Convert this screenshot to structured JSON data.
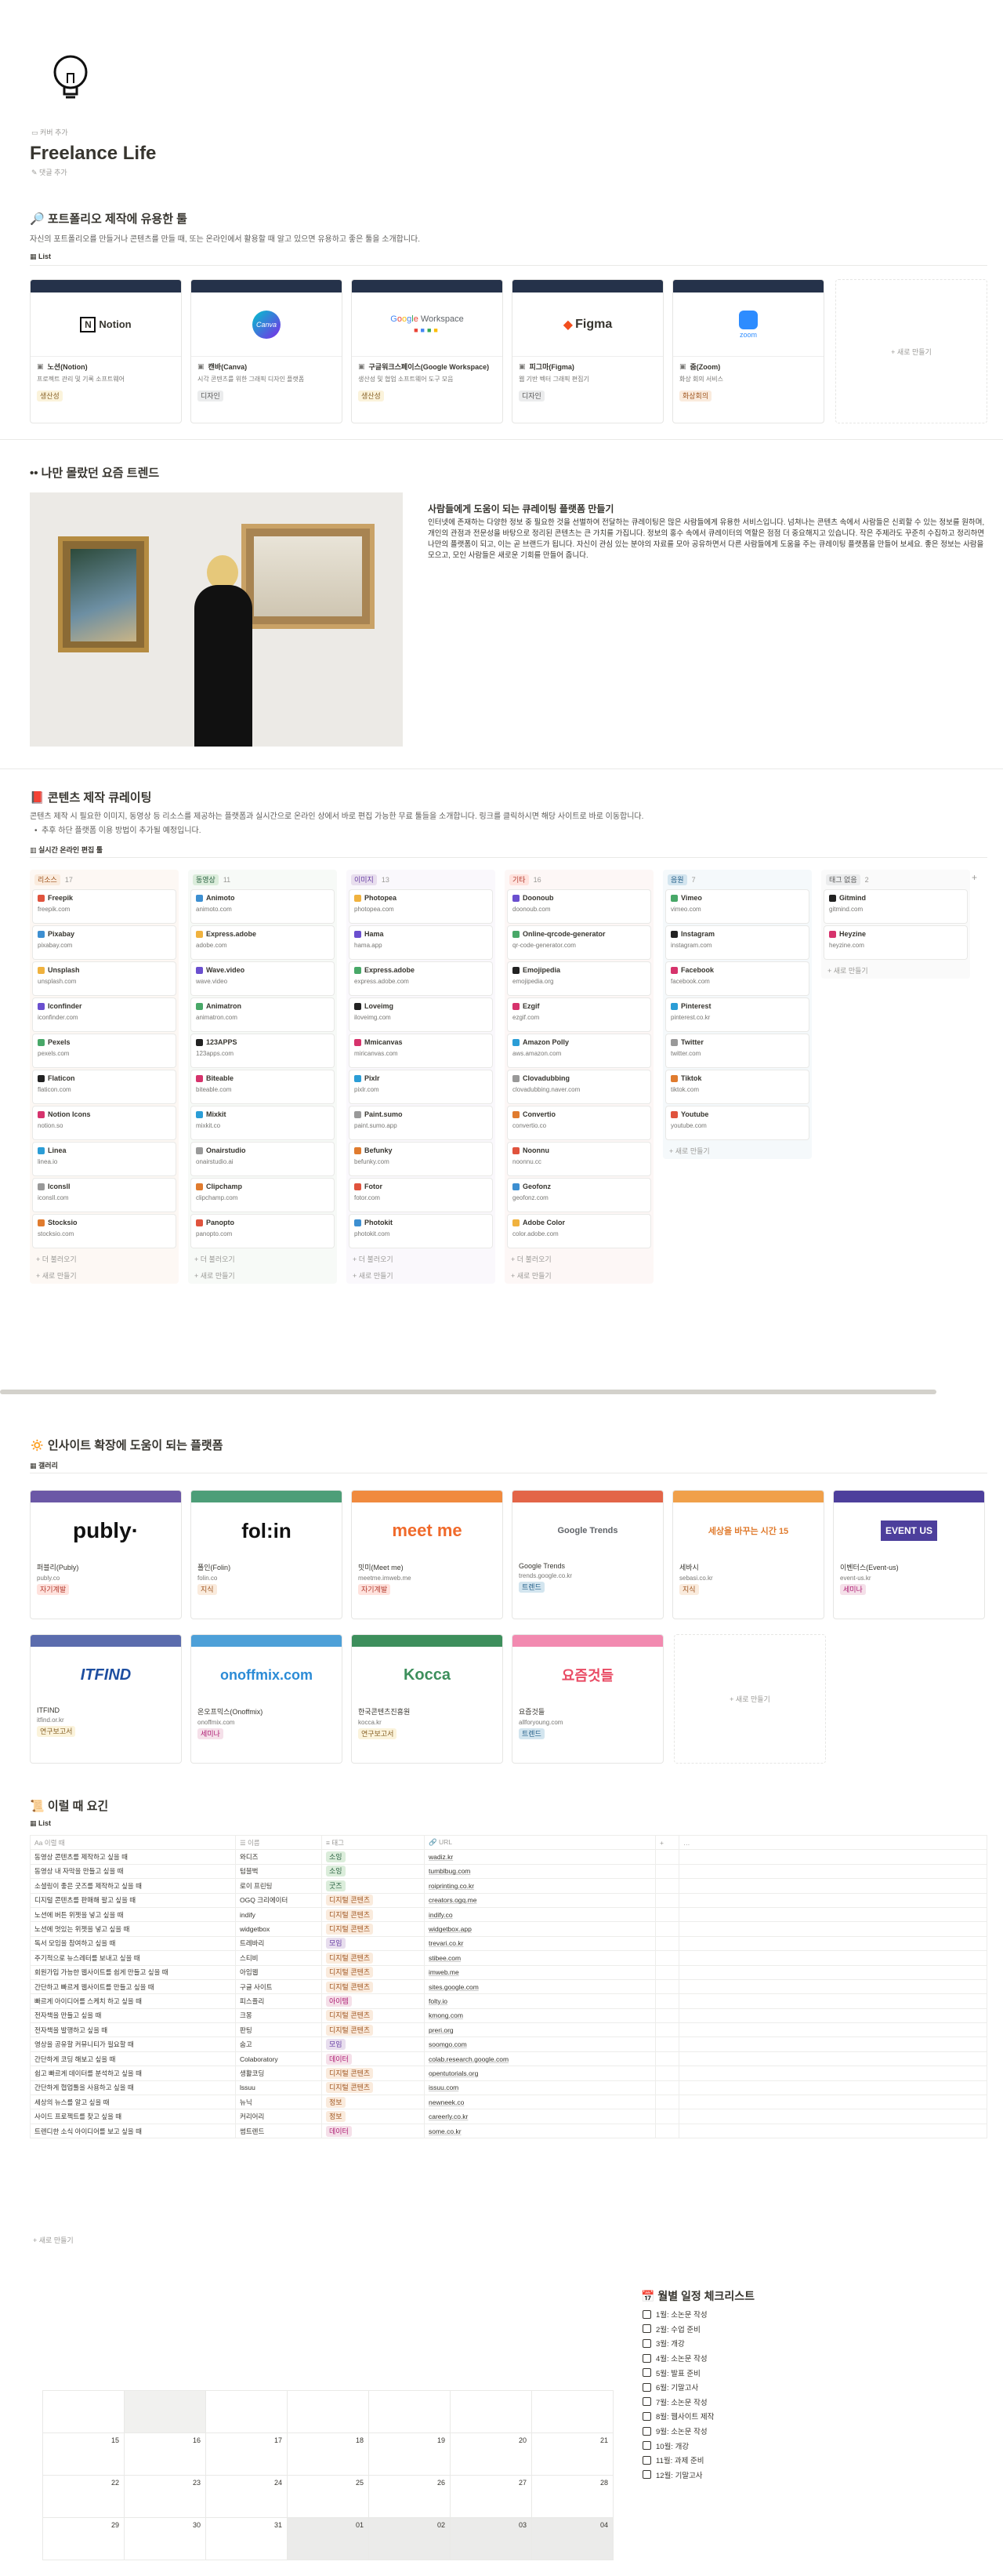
{
  "page": {
    "title": "Freelance Life",
    "add_cover": "커버 추가",
    "add_comment": "댓글 추가",
    "add_new": "+ 새로 만들기"
  },
  "tools": {
    "heading": "포트폴리오 제작에 유용한 툴",
    "desc": "자신의 포트폴리오를 만들거나 콘텐츠를 만들 때, 또는 온라인에서 활용할 때 알고 있으면 유용하고 좋은 툴을 소개합니다.",
    "view": "List",
    "cards": [
      {
        "name": "노션(Notion)",
        "desc": "프로젝트 관리 및 기록 소프트웨어",
        "tag": "생산성",
        "logo": "Notion"
      },
      {
        "name": "캔바(Canva)",
        "desc": "시각 콘텐츠를 위한 그래픽 디자인 플랫폼",
        "tag": "디자인",
        "logo": "Canva"
      },
      {
        "name": "구글워크스페이스(Google Workspace)",
        "desc": "생산성 및 협업 소프트웨어 도구 모음",
        "tag": "생산성",
        "logo": "Google Workspace"
      },
      {
        "name": "피그마(Figma)",
        "desc": "웹 기반 벡터 그래픽 편집기",
        "tag": "디자인",
        "logo": "Figma"
      },
      {
        "name": "줌(Zoom)",
        "desc": "화상 회의 서비스",
        "tag": "화상회의",
        "logo": "zoom"
      }
    ]
  },
  "trend": {
    "heading": "나만 몰랐던 요즘 트렌드",
    "title": "사람들에게 도움이 되는 큐레이팅 플랫폼 만들기",
    "body": "인터넷에 존재하는 다양한 정보 중 필요한 것을 선별하여 전달하는 큐레이팅은 많은 사람들에게 유용한 서비스입니다. 넘쳐나는 콘텐츠 속에서 사람들은 신뢰할 수 있는 정보를 원하며, 개인의 관점과 전문성을 바탕으로 정리된 콘텐츠는 큰 가치를 가집니다. 정보의 홍수 속에서 큐레이터의 역할은 점점 더 중요해지고 있습니다. 작은 주제라도 꾸준히 수집하고 정리하면 나만의 플랫폼이 되고, 이는 곧 브랜드가 됩니다. 자신이 관심 있는 분야의 자료를 모아 공유하면서 다른 사람들에게 도움을 주는 큐레이팅 플랫폼을 만들어 보세요. 좋은 정보는 사람을 모으고, 모인 사람들은 새로운 기회를 만들어 줍니다."
  },
  "content": {
    "heading": "콘텐츠 제작 큐레이팅",
    "desc": "콘텐츠 제작 시 필요한 이미지, 동영상 등 리소스를 제공하는 플랫폼과 실시간으로 온라인 상에서 바로 편집 가능한 무료 툴들을 소개합니다. 링크를 클릭하시면 해당 사이트로 바로 이동합니다.",
    "bullet": "추후 하단 플랫폼 이용 방법이 추가될 예정입니다.",
    "view": "실시간 온라인 편집 툴",
    "hidden": "+ 더 불러오기",
    "new": "+ 새로 만들기",
    "hide_group": "태그 없음",
    "columns": [
      {
        "name": "리소스",
        "count": "17",
        "tag": "t-orange",
        "bg": "#fdf8f4",
        "items": [
          [
            "Freepik",
            "freepik.com"
          ],
          [
            "Pixabay",
            "pixabay.com"
          ],
          [
            "Unsplash",
            "unsplash.com"
          ],
          [
            "Iconfinder",
            "iconfinder.com"
          ],
          [
            "Pexels",
            "pexels.com"
          ],
          [
            "Flaticon",
            "flaticon.com"
          ],
          [
            "Notion Icons",
            "notion.so"
          ],
          [
            "Linea",
            "linea.io"
          ],
          [
            "Iconsll",
            "iconsll.com"
          ],
          [
            "Stocksio",
            "stocksio.com"
          ]
        ]
      },
      {
        "name": "동영상",
        "count": "11",
        "tag": "t-green",
        "bg": "#f7faf7",
        "items": [
          [
            "Animoto",
            "animoto.com"
          ],
          [
            "Express.adobe",
            "adobe.com"
          ],
          [
            "Wave.video",
            "wave.video"
          ],
          [
            "Animatron",
            "animatron.com"
          ],
          [
            "123APPS",
            "123apps.com"
          ],
          [
            "Biteable",
            "biteable.com"
          ],
          [
            "Mixkit",
            "mixkit.co"
          ],
          [
            "Onairstudio",
            "onairstudio.ai"
          ],
          [
            "Clipchamp",
            "clipchamp.com"
          ],
          [
            "Panopto",
            "panopto.com"
          ]
        ]
      },
      {
        "name": "이미지",
        "count": "13",
        "tag": "t-purple",
        "bg": "#faf8fc",
        "items": [
          [
            "Photopea",
            "photopea.com"
          ],
          [
            "Hama",
            "hama.app"
          ],
          [
            "Express.adobe",
            "express.adobe.com"
          ],
          [
            "Loveimg",
            "iloveimg.com"
          ],
          [
            "Mmicanvas",
            "miricanvas.com"
          ],
          [
            "Pixlr",
            "pixlr.com"
          ],
          [
            "Paint.sumo",
            "paint.sumo.app"
          ],
          [
            "Befunky",
            "befunky.com"
          ],
          [
            "Fotor",
            "fotor.com"
          ],
          [
            "Photokit",
            "photokit.com"
          ]
        ]
      },
      {
        "name": "기타",
        "count": "16",
        "tag": "t-red",
        "bg": "#fdf7f6",
        "items": [
          [
            "Doonoub",
            "doonoub.com"
          ],
          [
            "Online-qrcode-generator",
            "qr-code-generator.com"
          ],
          [
            "Emojipedia",
            "emojipedia.org"
          ],
          [
            "Ezgif",
            "ezgif.com"
          ],
          [
            "Amazon Polly",
            "aws.amazon.com"
          ],
          [
            "Clovadubbing",
            "clovadubbing.naver.com"
          ],
          [
            "Convertio",
            "convertio.co"
          ],
          [
            "Noonnu",
            "noonnu.cc"
          ],
          [
            "Geofonz",
            "geofonz.com"
          ],
          [
            "Adobe Color",
            "color.adobe.com"
          ]
        ]
      },
      {
        "name": "음원",
        "count": "7",
        "tag": "t-blue",
        "bg": "#f5f9fb",
        "items": [
          [
            "Vimeo",
            "vimeo.com"
          ],
          [
            "Instagram",
            "instagram.com"
          ],
          [
            "Facebook",
            "facebook.com"
          ],
          [
            "Pinterest",
            "pinterest.co.kr"
          ],
          [
            "Twitter",
            "twitter.com"
          ],
          [
            "Tiktok",
            "tiktok.com"
          ],
          [
            "Youtube",
            "youtube.com"
          ]
        ]
      },
      {
        "name": "태그 없음",
        "count": "2",
        "tag": "t-gray",
        "bg": "#fafafa",
        "items": [
          [
            "Gitmind",
            "gitmind.com"
          ],
          [
            "Heyzine",
            "heyzine.com"
          ]
        ]
      }
    ]
  },
  "insight": {
    "heading": "인사이트 확장에 도움이 되는 플랫폼",
    "view": "갤러리",
    "cards": [
      {
        "name": "퍼블리(Publy)",
        "url": "publy.co",
        "tag": "자기계발",
        "logo": "publy·",
        "bar": "#6b58a6"
      },
      {
        "name": "폴인(Folin)",
        "url": "folin.co",
        "tag": "지식",
        "logo": "fol:in",
        "bar": "#4d9e78"
      },
      {
        "name": "밋미(Meet me)",
        "url": "meetme.imweb.me",
        "tag": "자기계발",
        "logo": "meet me",
        "bar": "#f08a3e"
      },
      {
        "name": "Google Trends",
        "url": "trends.google.co.kr",
        "tag": "트렌드",
        "logo": "Google Trends",
        "bar": "#e36548"
      },
      {
        "name": "세바시",
        "url": "sebasi.co.kr",
        "tag": "지식",
        "logo": "세상을 바꾸는 시간 15",
        "bar": "#f0a04a"
      },
      {
        "name": "이벤터스(Event-us)",
        "url": "event-us.kr",
        "tag": "세미나",
        "logo": "EVENT US",
        "bar": "#4d3f9c"
      },
      {
        "name": "ITFIND",
        "url": "itfind.or.kr",
        "tag": "연구보고서",
        "logo": "ITFIND",
        "bar": "#5b6cad"
      },
      {
        "name": "온오프믹스(Onoffmix)",
        "url": "onoffmix.com",
        "tag": "세미나",
        "logo": "onoffmix.com",
        "bar": "#4da0d8"
      },
      {
        "name": "한국콘텐츠진흥원",
        "url": "kocca.kr",
        "tag": "연구보고서",
        "logo": "Kocca",
        "bar": "#3d8f5c"
      },
      {
        "name": "요즘것들",
        "url": "allforyoung.com",
        "tag": "트렌드",
        "logo": "요즘것들",
        "bar": "#f28ab0"
      }
    ]
  },
  "idea": {
    "heading": "이럴 때 요긴",
    "view": "List",
    "headers": [
      "이럴 때",
      "이름",
      "태그",
      "URL"
    ],
    "rows": [
      [
        "동영상 콘텐츠를 제작하고 싶을 때",
        "와디즈",
        "소잉",
        "wadiz.kr"
      ],
      [
        "동영상 내 자막을 만들고 싶을 때",
        "텀블벅",
        "소잉",
        "tumblbug.com"
      ],
      [
        "소셜링이 좋은 굿즈를 제작하고 싶을 때",
        "로이 프린팅",
        "굿즈",
        "roiprinting.co.kr"
      ],
      [
        "디지털 콘텐츠를 판매해 팔고 싶을 때",
        "OGQ 크리에이터",
        "디지털 콘텐츠",
        "creators.ogq.me"
      ],
      [
        "노션에 버튼 위젯을 넣고 싶을 때",
        "indify",
        "디지털 콘텐츠",
        "indify.co"
      ],
      [
        "노션에 멋있는 위젯을 넣고 싶을 때",
        "widgetbox",
        "디지털 콘텐츠",
        "widgetbox.app"
      ],
      [
        "독서 모임을 참여하고 싶을 때",
        "트레바리",
        "모임",
        "trevari.co.kr"
      ],
      [
        "주기적으로 뉴스레터를 보내고 싶을 때",
        "스티비",
        "디지털 콘텐츠",
        "stibee.com"
      ],
      [
        "회원가입 가능한 웹사이트를 쉽게 만들고 싶을 때",
        "아임웹",
        "디지털 콘텐츠",
        "imweb.me"
      ],
      [
        "간단하고 빠르게 웹사이트를 만들고 싶을 때",
        "구글 사이트",
        "디지털 콘텐츠",
        "sites.google.com"
      ],
      [
        "빠르게 아이디어를 스케치 하고 싶을 때",
        "피스플리",
        "아이템",
        "folty.io"
      ],
      [
        "전자책을 만들고 싶을 때",
        "크몽",
        "디지털 콘텐츠",
        "kmong.com"
      ],
      [
        "전자책을 발행하고 싶을 때",
        "판팅",
        "디지털 콘텐츠",
        "preri.org"
      ],
      [
        "영상을 공유할 커뮤니티가 필요할 때",
        "숨고",
        "모임",
        "soomgo.com"
      ],
      [
        "간단하게 코딩 해보고 싶을 때",
        "Colaboratory",
        "데이터",
        "colab.research.google.com"
      ],
      [
        "쉽고 빠르게 데이터를 분석하고 싶을 때",
        "생활코딩",
        "디지털 콘텐츠",
        "opentutorials.org"
      ],
      [
        "간단하게 협업툴을 사용하고 싶을 때",
        "lssuu",
        "디지털 콘텐츠",
        "issuu.com"
      ],
      [
        "세상의 뉴스를 알고 싶을 때",
        "뉴닉",
        "정보",
        "newneek.co"
      ],
      [
        "사이드 프로젝트를 찾고 싶을 때",
        "커리어리",
        "정보",
        "careerly.co.kr"
      ],
      [
        "트렌디한 소식 아이디어를 보고 싶을 때",
        "썸트렌드",
        "데이터",
        "some.co.kr"
      ]
    ]
  },
  "calendar": {
    "weeks": [
      [
        "",
        "",
        "",
        "",
        "",
        "",
        ""
      ],
      [
        "15",
        "16",
        "17",
        "18",
        "19",
        "20",
        "21"
      ],
      [
        "22",
        "23",
        "24",
        "25",
        "26",
        "27",
        "28"
      ],
      [
        "29",
        "30",
        "31",
        "01",
        "02",
        "03",
        "04"
      ]
    ]
  },
  "checklist": {
    "heading": "월별 일정 체크리스트",
    "items": [
      "1월: 소논문 작성",
      "2월: 수업 준비",
      "3월: 개강",
      "4월: 소논문 작성",
      "5월: 발표 준비",
      "6월: 기말고사",
      "7월: 소논문 작성",
      "8월: 웹사이트 제작",
      "9월: 소논문 작성",
      "10월: 개강",
      "11월: 과제 준비",
      "12월: 기말고사"
    ]
  },
  "colors": {
    "accent": "#25324a",
    "divider": "#e9e9e7"
  }
}
